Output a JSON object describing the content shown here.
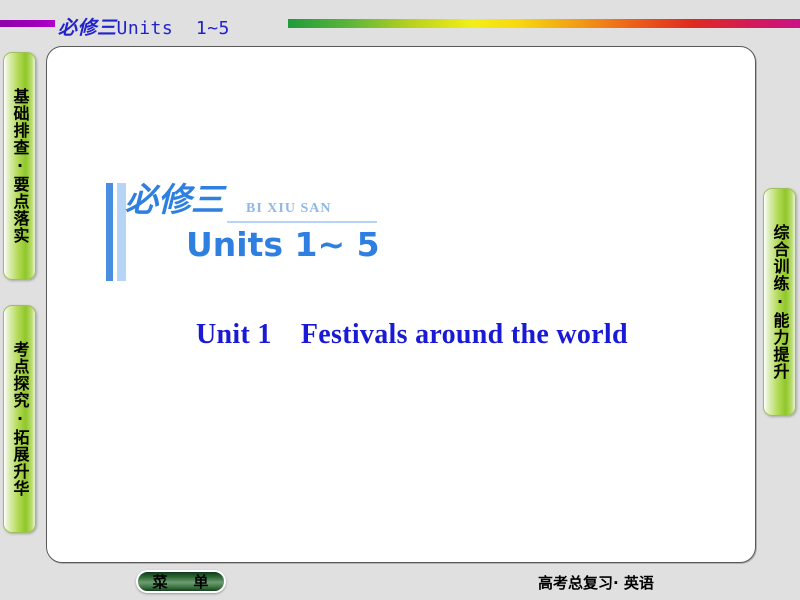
{
  "header": {
    "book_label": "必修三",
    "units_label": "Units  1~5",
    "left_bar_color": "#9c00b8",
    "rainbow_bar_colors": [
      "#1f9c3a",
      "#b8d11f",
      "#f2ef18",
      "#ec5d1a",
      "#cc1188"
    ],
    "title_color": "#2222cc"
  },
  "sidebar": {
    "left_tabs": [
      {
        "label": "基础排查·要点落实",
        "name": "tab-basic"
      },
      {
        "label": "考点探究·拓展升华",
        "name": "tab-explore"
      }
    ],
    "right_tabs": [
      {
        "label": "综合训练·能力提升",
        "name": "tab-train"
      }
    ],
    "tab_accent_color": "#8fc728"
  },
  "main": {
    "book_title_cn": "必修三",
    "book_title_pinyin": "BI XIU SAN",
    "units_title": "Units 1~ 5",
    "unit_heading": "Unit 1    Festivals around the world",
    "accent_blue": "#2f7fe0",
    "heading_blue": "#1a1ad6"
  },
  "footer": {
    "menu_label": "菜    单",
    "series_label": "高考总复习· 英语"
  }
}
